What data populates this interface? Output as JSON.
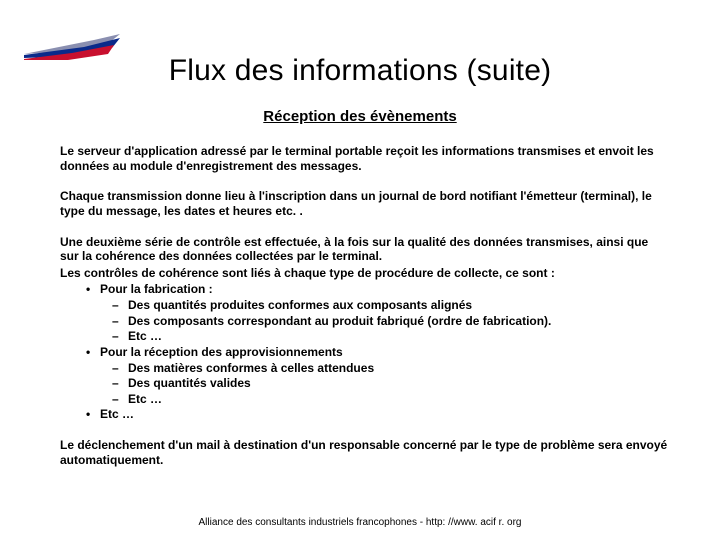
{
  "title": "Flux des informations (suite)",
  "subtitle": "Réception des évènements",
  "paragraphs": {
    "p1": "Le serveur d'application adressé par le terminal portable reçoit les informations transmises et envoit les données au module d'enregistrement des messages.",
    "p2": "Chaque transmission donne lieu à l'inscription dans un journal de bord notifiant l'émetteur (terminal), le type du message, les dates et heures etc. .",
    "p3a": "Une deuxième série de contrôle est effectuée, à la fois sur la qualité des données transmises, ainsi que sur la cohérence des données collectées par le terminal.",
    "p3b": "Les contrôles de cohérence sont liés à chaque type de procédure de collecte, ce sont :",
    "p4": "Le déclenchement d'un mail à destination d'un responsable concerné par le type de problème sera envoyé automatiquement."
  },
  "bullets": {
    "fab_label": "Pour la fabrication :",
    "fab": {
      "i1": "Des quantités produites conformes aux composants alignés",
      "i2": "Des composants correspondant au produit fabriqué (ordre de fabrication).",
      "i3": "Etc …"
    },
    "appro_label": "Pour la réception des approvisionnements",
    "appro": {
      "i1": "Des matières conformes à celles attendues",
      "i2": "Des quantités valides",
      "i3": "Etc …"
    },
    "etc_label": "Etc …"
  },
  "footer": "Alliance des consultants industriels francophones  -  http: //www. acif r. org"
}
